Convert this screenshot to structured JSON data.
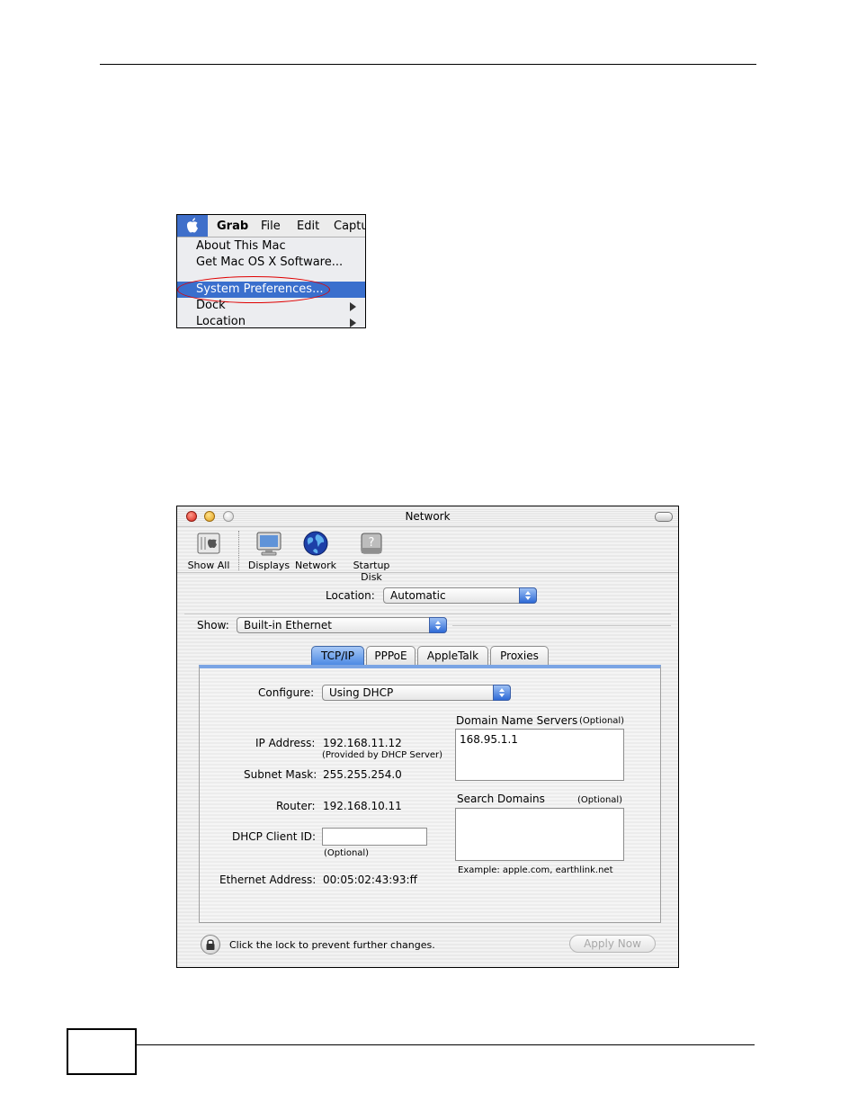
{
  "apple_menu": {
    "menubar": [
      "Grab",
      "File",
      "Edit",
      "Captu"
    ],
    "items": [
      {
        "label": "About This Mac"
      },
      {
        "label": "Get Mac OS X Software..."
      },
      {
        "label": "System Preferences..."
      },
      {
        "label": "Dock"
      },
      {
        "label": "Location"
      }
    ]
  },
  "network_window": {
    "title": "Network",
    "toolbar": {
      "show_all": "Show All",
      "displays": "Displays",
      "network": "Network",
      "startup_disk": "Startup Disk"
    },
    "location": {
      "label": "Location:",
      "value": "Automatic"
    },
    "show": {
      "label": "Show:",
      "value": "Built-in Ethernet"
    },
    "tabs": [
      "TCP/IP",
      "PPPoE",
      "AppleTalk",
      "Proxies"
    ],
    "configure": {
      "label": "Configure:",
      "value": "Using DHCP"
    },
    "ip_address": {
      "label": "IP Address:",
      "value": "192.168.11.12",
      "note": "(Provided by DHCP Server)"
    },
    "subnet_mask": {
      "label": "Subnet Mask:",
      "value": "255.255.254.0"
    },
    "router": {
      "label": "Router:",
      "value": "192.168.10.11"
    },
    "dhcp_client_id": {
      "label": "DHCP Client ID:",
      "value": "",
      "note": "(Optional)"
    },
    "ethernet_address": {
      "label": "Ethernet Address:",
      "value": "00:05:02:43:93:ff"
    },
    "dns": {
      "label": "Domain Name Servers",
      "optional": "(Optional)",
      "value": "168.95.1.1"
    },
    "search_domains": {
      "label": "Search Domains",
      "optional": "(Optional)",
      "value": "",
      "example": "Example: apple.com, earthlink.net"
    },
    "lock_text": "Click the lock to prevent further changes.",
    "apply_button": "Apply Now"
  }
}
